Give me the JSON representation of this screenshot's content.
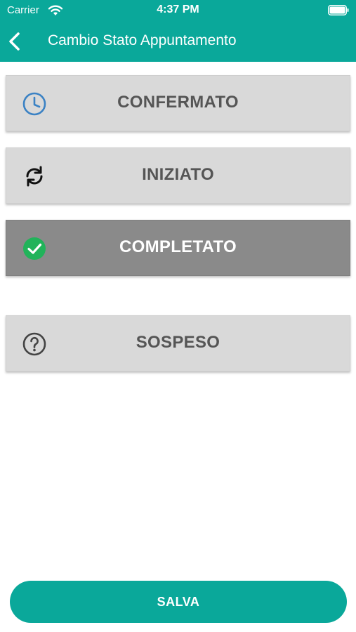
{
  "status_bar": {
    "carrier": "Carrier",
    "time": "4:37 PM"
  },
  "header": {
    "title": "Cambio Stato Appuntamento",
    "back_icon": "chevron-left-icon",
    "background_color": "#0aa89a"
  },
  "options": [
    {
      "label": "CONFERMATO",
      "icon": "clock-icon",
      "icon_color": "#3b82c4",
      "selected": false
    },
    {
      "label": "INIZIATO",
      "icon": "sync-icon",
      "icon_color": "#111111",
      "selected": false
    },
    {
      "label": "COMPLETATO",
      "icon": "check-circle-icon",
      "icon_color": "#21b35a",
      "selected": true
    },
    {
      "label": "SOSPESO",
      "icon": "question-circle-icon",
      "icon_color": "#444444",
      "selected": false
    }
  ],
  "save_button": {
    "label": "SALVA",
    "color": "#0aa89a"
  }
}
